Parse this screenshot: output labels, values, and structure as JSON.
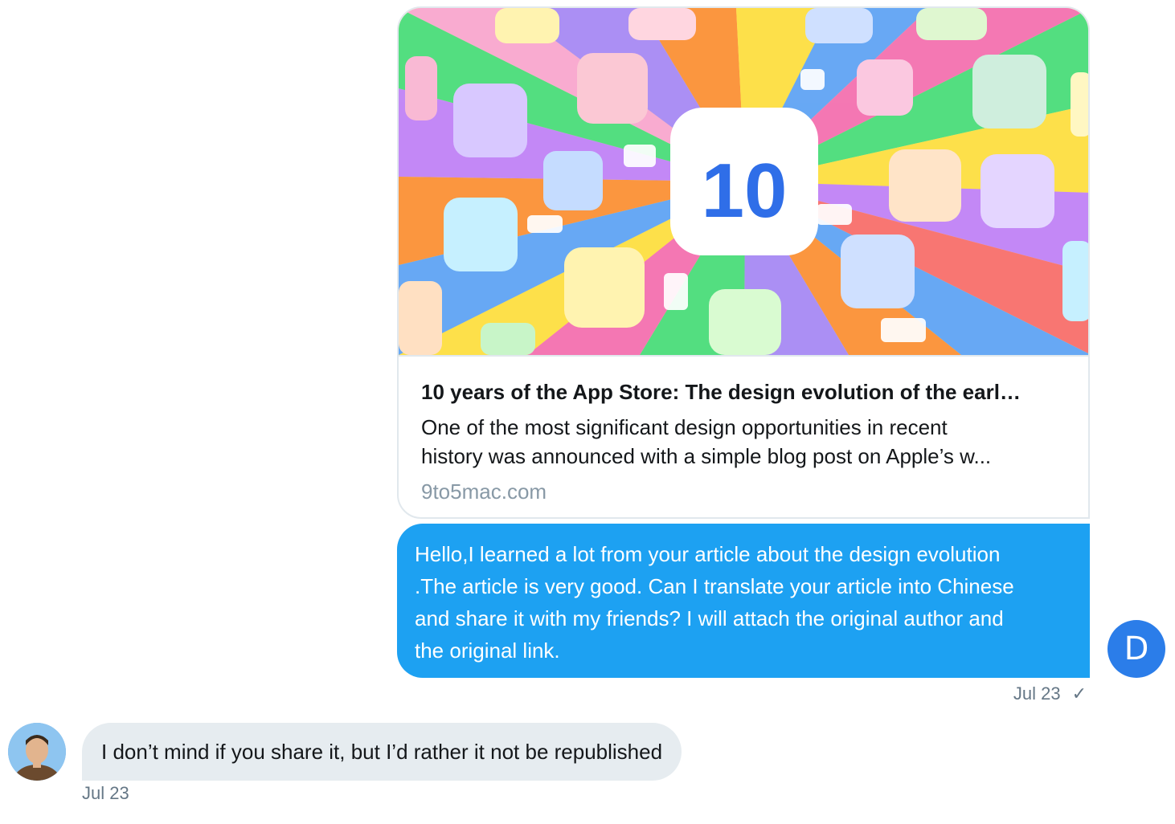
{
  "link_card": {
    "image_badge": "10",
    "title": "10 years of the App Store: The design evolution of the earl…",
    "description_lines": [
      "One of the most significant design opportunities in recent",
      "history was announced with a simple blog post on Apple’s w..."
    ],
    "domain": "9to5mac.com"
  },
  "sent_message": {
    "lines": [
      "Hello,I learned a lot from your article about the design evolution",
      ".The article is very good. Can I translate your article into Chinese",
      "and share it with my friends? I will attach the original author and",
      "the original link."
    ],
    "timestamp": "Jul 23",
    "status_icon": "check-icon",
    "avatar_initial": "D"
  },
  "received_message": {
    "text": "I don’t mind if you share it, but I’d rather it not be republished",
    "timestamp": "Jul 23",
    "avatar": "user-photo"
  },
  "colors": {
    "sent_bubble": "#1da1f2",
    "received_bubble": "#e6ecf0",
    "avatar_d": "#2b7de9",
    "meta_text": "#657786",
    "domain_text": "#8899a6"
  }
}
